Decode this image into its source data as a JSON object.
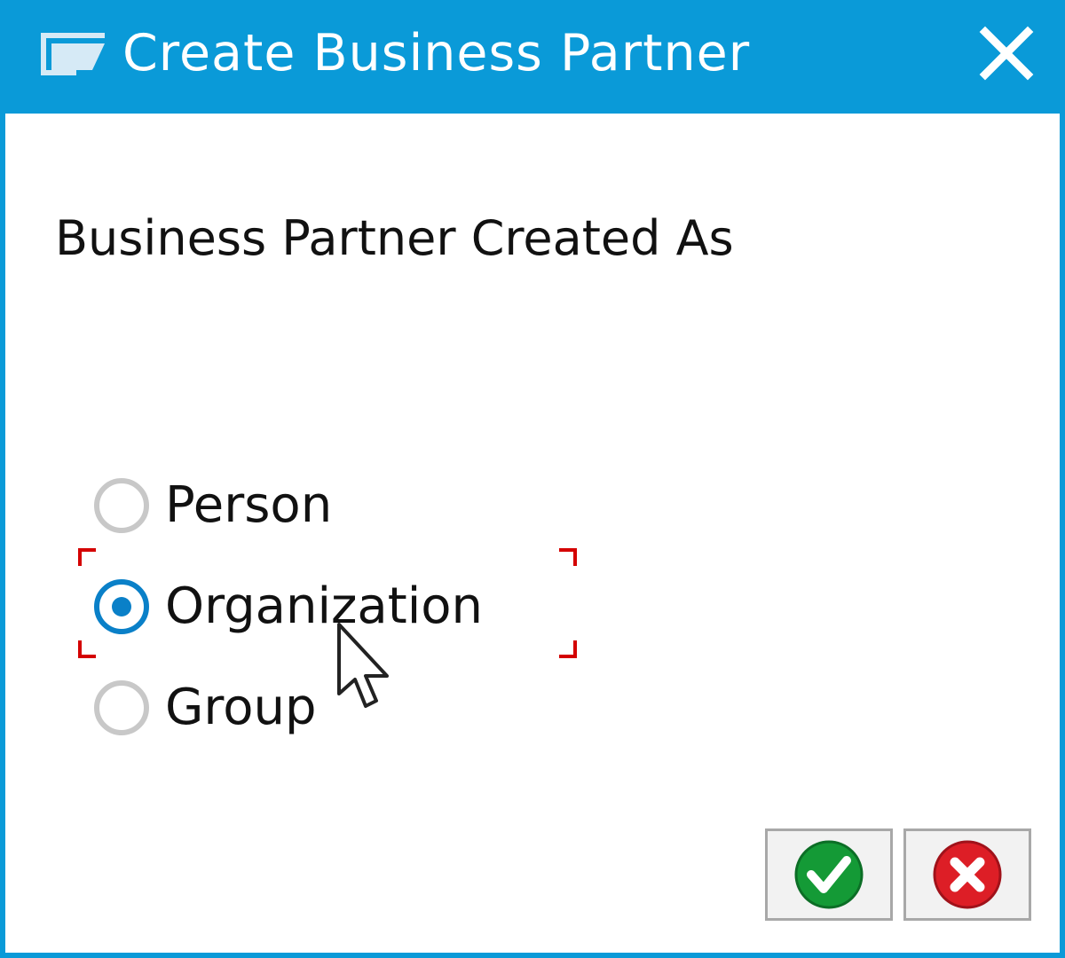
{
  "window": {
    "title": "Create Business Partner",
    "title_icon": "window-icon",
    "close_icon": "close-icon",
    "colors": {
      "titlebar": "#0a9ad8",
      "border": "#0a9ad8",
      "focus_frame": "#d40000"
    }
  },
  "form": {
    "group_label": "Business Partner Created As",
    "options": [
      {
        "label": "Person",
        "checked": false
      },
      {
        "label": "Organization",
        "checked": true
      },
      {
        "label": "Group",
        "checked": false
      }
    ],
    "selected": "Organization",
    "focused": "Organization"
  },
  "buttons": {
    "confirm_icon": "green-checkmark-icon",
    "cancel_icon": "red-x-icon"
  }
}
